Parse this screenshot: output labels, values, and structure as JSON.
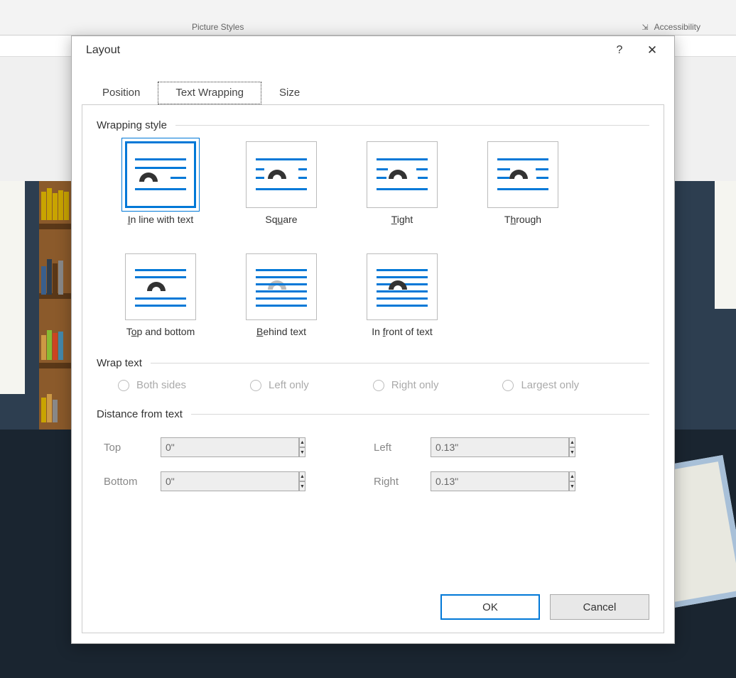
{
  "ribbon": {
    "picture_styles": "Picture Styles",
    "accessibility": "Accessibility"
  },
  "dialog": {
    "title": "Layout",
    "help": "?",
    "close": "✕",
    "tabs": {
      "position": "Position",
      "text_wrapping": "Text Wrapping",
      "size": "Size"
    },
    "groups": {
      "wrapping_style": "Wrapping style",
      "wrap_text": "Wrap text",
      "distance": "Distance from text"
    },
    "styles": {
      "inline": {
        "pre": "",
        "u": "I",
        "post": "n line with text"
      },
      "square": {
        "pre": "Sq",
        "u": "u",
        "post": "are"
      },
      "tight": {
        "pre": "",
        "u": "T",
        "post": "ight"
      },
      "through": {
        "pre": "T",
        "u": "h",
        "post": "rough"
      },
      "topbottom": {
        "pre": "T",
        "u": "o",
        "post": "p and bottom"
      },
      "behind": {
        "pre": "",
        "u": "B",
        "post": "ehind text"
      },
      "front": {
        "pre": "In ",
        "u": "f",
        "post": "ront of text"
      }
    },
    "wrap_options": {
      "both": "Both sides",
      "left": "Left only",
      "right": "Right only",
      "largest": "Largest only"
    },
    "distance": {
      "top_label": "Top",
      "top_value": "0\"",
      "bottom_label": "Bottom",
      "bottom_value": "0\"",
      "left_label": "Left",
      "left_value": "0.13\"",
      "right_label": "Right",
      "right_value": "0.13\""
    },
    "buttons": {
      "ok": "OK",
      "cancel": "Cancel"
    }
  }
}
